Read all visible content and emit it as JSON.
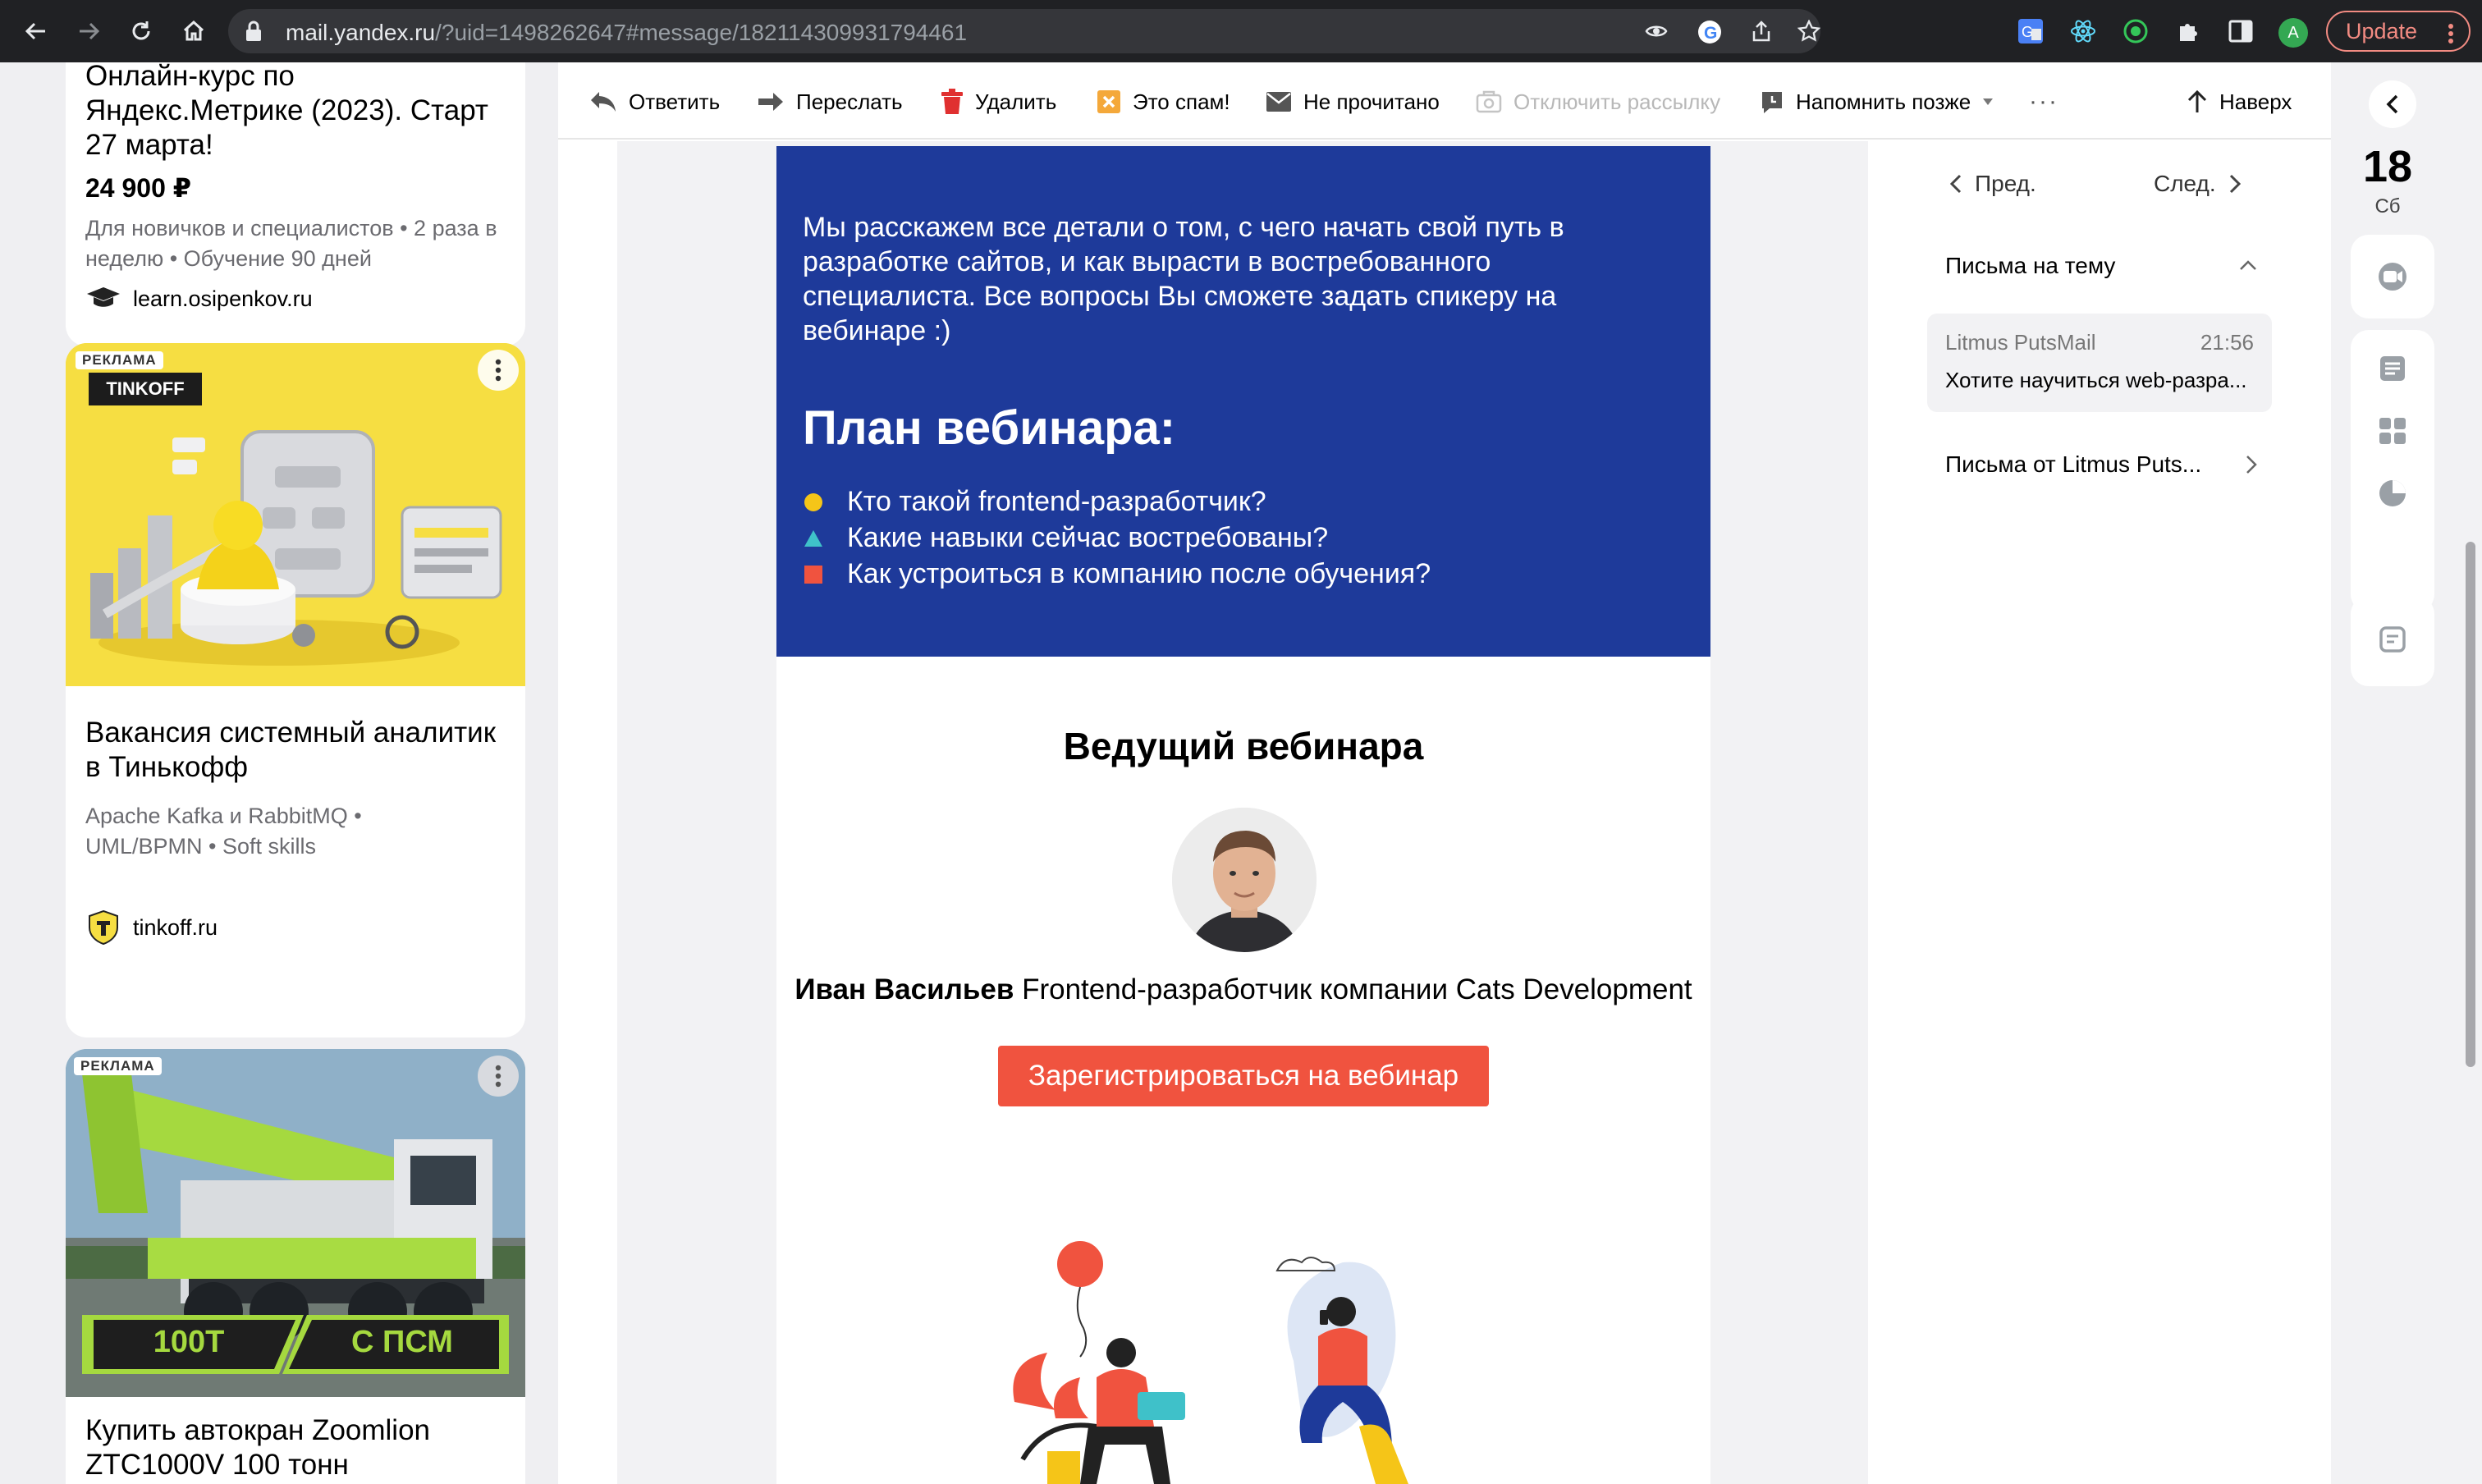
{
  "browser": {
    "url_host": "mail.yandex.ru",
    "url_path": "/?uid=1498262647#message/182114309931794461",
    "avatar_letter": "A",
    "update_label": "Update"
  },
  "ads": [
    {
      "title": "Онлайн-курс по Яндекс.Метрике (2023). Старт 27 марта!",
      "price": "24 900 ₽",
      "meta": "Для новичков и специалистов • 2 раза в неделю • Обучение 90 дней",
      "site": "learn.osipenkov.ru"
    },
    {
      "badge": "РЕКЛАМА",
      "brand": "TINKOFF",
      "title": "Вакансия системный аналитик в Тинькофф",
      "meta": "Apache Kafka и RabbitMQ • UML/BPMN • Soft skills",
      "site": "tinkoff.ru"
    },
    {
      "badge": "РЕКЛАМА",
      "banner_left": "100Т",
      "banner_right": "С ПСМ",
      "title": "Купить автокран Zoomlion ZTC1000V 100 тонн"
    }
  ],
  "toolbar": {
    "reply": "Ответить",
    "forward": "Переслать",
    "delete": "Удалить",
    "spam": "Это спам!",
    "unread": "Не прочитано",
    "unsubscribe": "Отключить рассылку",
    "remind": "Напомнить позже",
    "more": "···",
    "top": "Наверх"
  },
  "message": {
    "intro": "Мы расскажем все детали о том, с чего начать свой путь в разработке сайтов, и как вырасти в востребованного специалиста. Все вопросы Вы сможете задать спикеру на вебинаре :)",
    "plan_title": "План вебинара:",
    "plan_items": [
      "Кто такой frontend-разработчик?",
      "Какие навыки сейчас востребованы?",
      "Как устроиться в компанию после обучения?"
    ],
    "host_title": "Ведущий вебинара",
    "host_name": "Иван Васильев",
    "host_role": "Frontend-разработчик компании Cats Development",
    "register_label": "Зарегистрироваться на вебинар"
  },
  "info_panel": {
    "prev": "Пред.",
    "next": "След.",
    "thread_title": "Письма на тему",
    "thread_from": "Litmus PutsMail",
    "thread_time": "21:56",
    "thread_subject": "Хотите научиться web-разра...",
    "from_row": "Письма от Litmus Puts..."
  },
  "calendar": {
    "day": "18",
    "dow": "Сб"
  },
  "colors": {
    "blue_block": "#1e3a9a",
    "register": "#f0533f",
    "bullet_yellow": "#f5c518",
    "bullet_teal": "#3fc1c9",
    "bullet_red": "#f0533f"
  }
}
